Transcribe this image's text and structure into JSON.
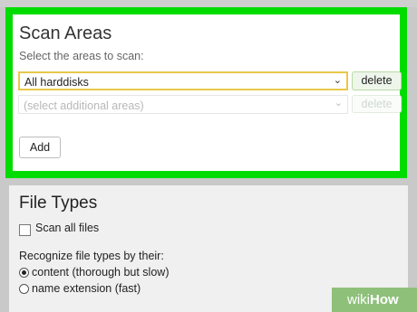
{
  "scan_areas": {
    "title": "Scan Areas",
    "subtitle": "Select the areas to scan:",
    "selected_area": "All harddisks",
    "additional_placeholder": "(select additional areas)",
    "delete_label": "delete",
    "add_label": "Add",
    "highlight_color": "#00dc00"
  },
  "file_types": {
    "title": "File Types",
    "scan_all_label": "Scan all files",
    "scan_all_checked": false,
    "recognize_label": "Recognize file types by their:",
    "options": [
      {
        "label": "content (thorough but slow)",
        "selected": true
      },
      {
        "label": "name extension (fast)",
        "selected": false
      }
    ]
  },
  "watermark": {
    "brand": "wiki",
    "brand_bold": "How"
  }
}
